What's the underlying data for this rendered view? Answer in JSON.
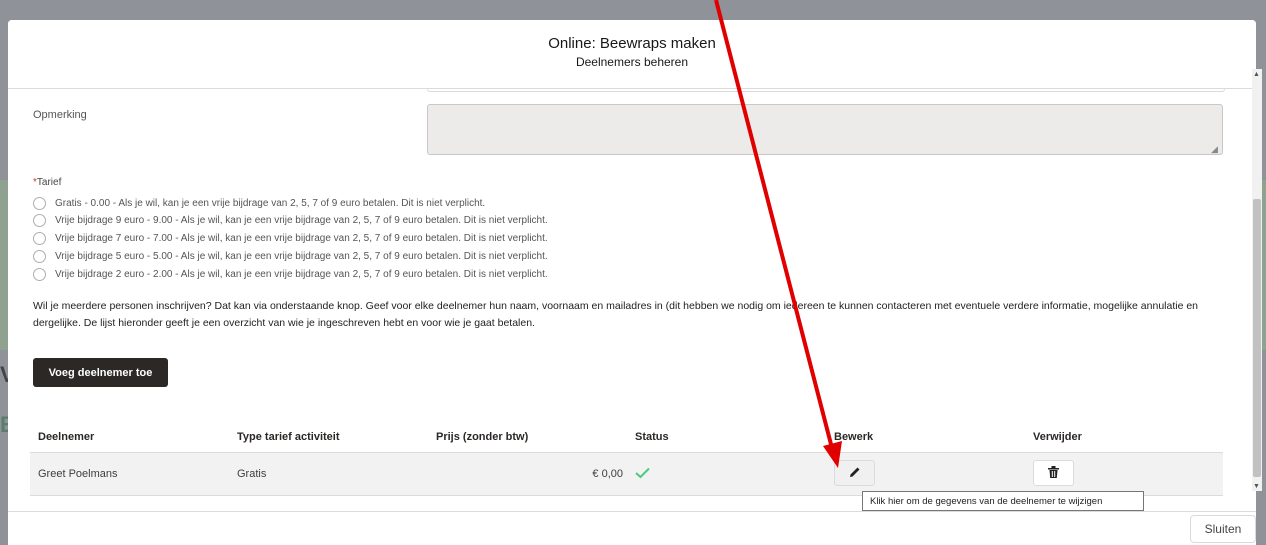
{
  "modal": {
    "title": "Online: Beewraps maken",
    "subtitle": "Deelnemers beheren"
  },
  "form": {
    "remark_label": "Opmerking",
    "remark_value": "",
    "tarief_required": "*",
    "tarief_label": "Tarief",
    "tarief_options": [
      "Gratis - 0.00 - Als je wil, kan je een vrije bijdrage van 2, 5, 7 of 9 euro betalen. Dit is niet verplicht.",
      "Vrije bijdrage 9 euro - 9.00 - Als je wil, kan je een vrije bijdrage van 2, 5, 7 of 9 euro betalen. Dit is niet verplicht.",
      "Vrije bijdrage 7 euro - 7.00 - Als je wil, kan je een vrije bijdrage van 2, 5, 7 of 9 euro betalen. Dit is niet verplicht.",
      "Vrije bijdrage 5 euro - 5.00 - Als je wil, kan je een vrije bijdrage van 2, 5, 7 of 9 euro betalen. Dit is niet verplicht.",
      "Vrije bijdrage 2 euro - 2.00 - Als je wil, kan je een vrije bijdrage van 2, 5, 7 of 9 euro betalen. Dit is niet verplicht."
    ],
    "intro_text": "Wil je meerdere personen inschrijven? Dat kan via onderstaande knop. Geef voor elke deelnemer hun naam, voornaam en mailadres in (dit hebben we nodig om iedereen te kunnen contacteren met eventuele verdere informatie, mogelijke annulatie en dergelijke. De lijst hieronder geeft je een overzicht van wie je ingeschreven hebt en voor wie je gaat betalen.",
    "add_button": "Voeg deelnemer toe"
  },
  "table": {
    "headers": {
      "participant": "Deelnemer",
      "type": "Type tarief activiteit",
      "price": "Prijs (zonder btw)",
      "status": "Status",
      "edit": "Bewerk",
      "delete": "Verwijder"
    },
    "rows": [
      {
        "participant": "Greet Poelmans",
        "type": "Gratis",
        "price": "€ 0,00",
        "status_icon": "check-icon",
        "edit_icon": "pencil-icon",
        "delete_icon": "trash-icon"
      }
    ]
  },
  "tooltip": "Klik hier om de gegevens van de deelnemer te wijzigen",
  "footer": {
    "close_button": "Sluiten"
  },
  "background": {
    "letter_1": "V",
    "letter_2": "B"
  },
  "colors": {
    "annotation_arrow": "#e00000",
    "status_ok": "#4bca81",
    "primary_button": "#2b2826"
  }
}
